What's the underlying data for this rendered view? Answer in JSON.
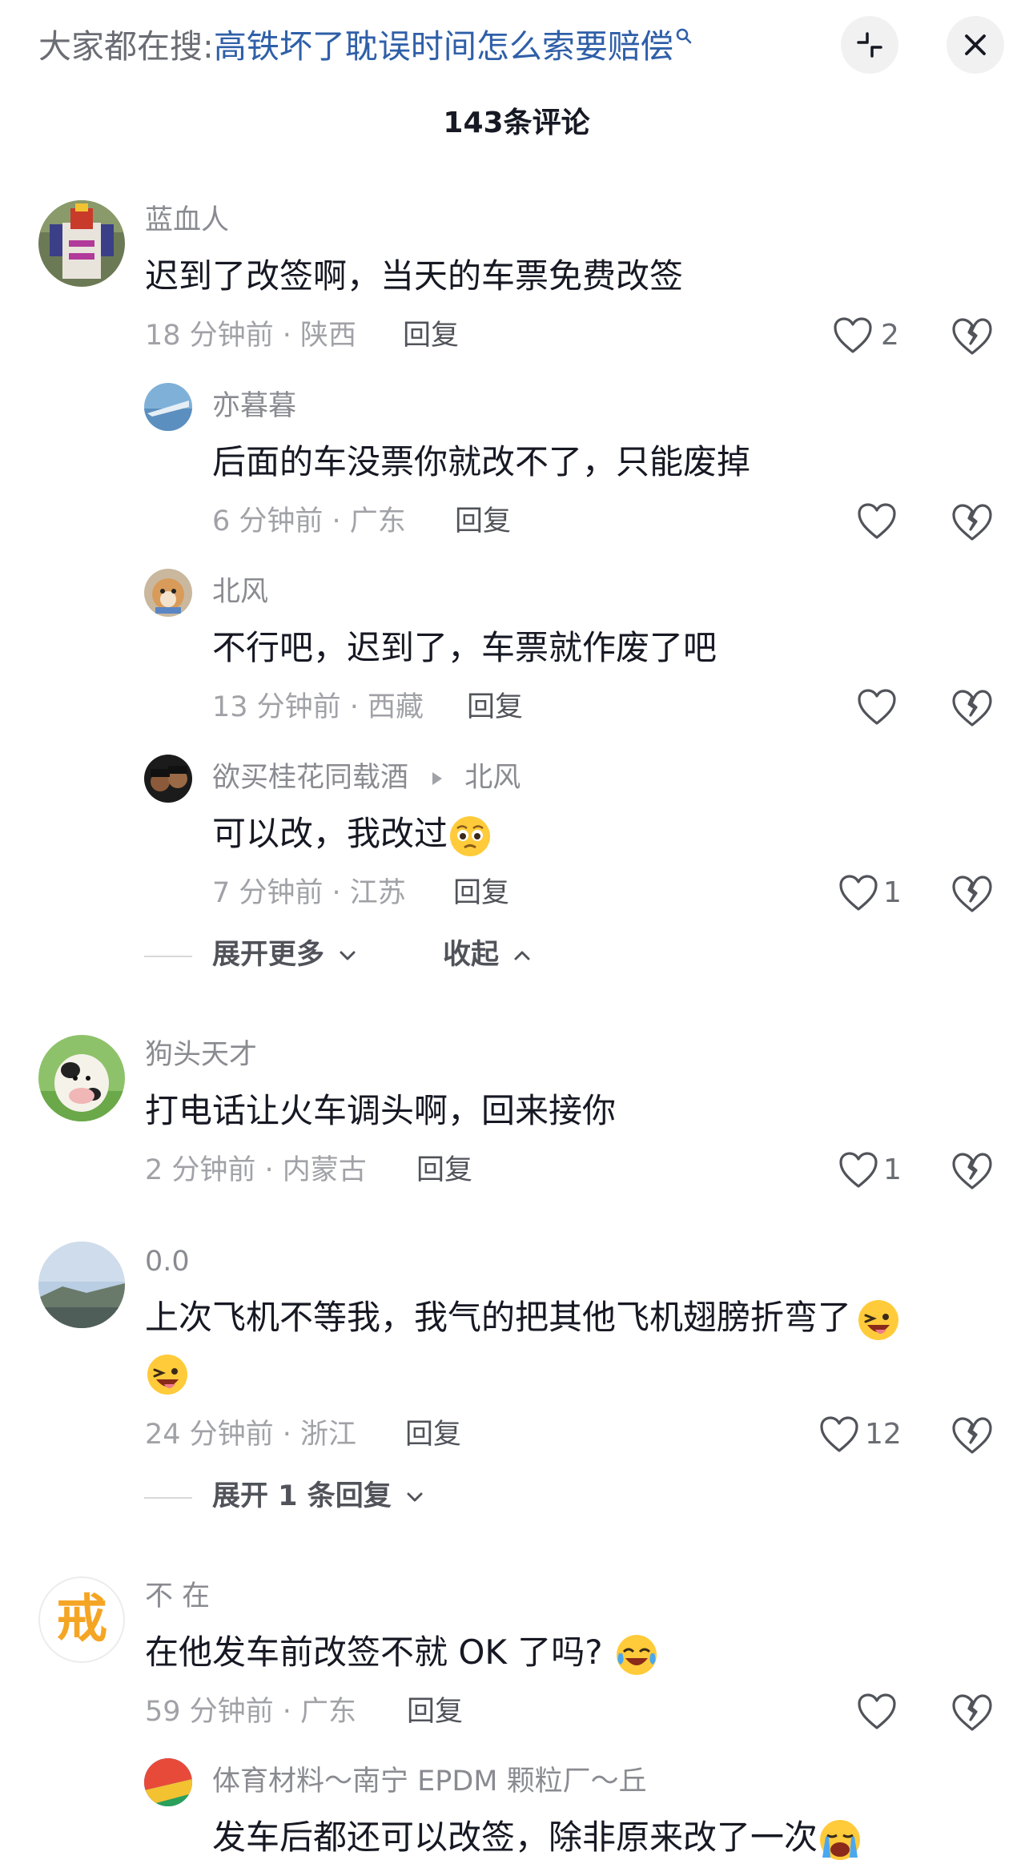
{
  "header": {
    "search_prefix": "大家都在搜:",
    "search_query": "高铁坏了耽误时间怎么索要赔偿",
    "search_icon": "search-icon",
    "minimize_icon": "minimize-icon",
    "close_icon": "close-icon"
  },
  "comments_header": {
    "count_label": "143条评论"
  },
  "comments": [
    {
      "username": "蓝血人",
      "text": "迟到了改签啊，当天的车票免费改签",
      "meta": "18 分钟前 · 陕西",
      "reply_label": "回复",
      "likes": "2",
      "replies": [
        {
          "username": "亦暮暮",
          "text": "后面的车没票你就改不了，只能废掉",
          "meta": "6 分钟前 · 广东",
          "reply_label": "回复",
          "likes": ""
        },
        {
          "username": "北风",
          "text": "不行吧，迟到了，车票就作废了吧",
          "meta": "13 分钟前 · 西藏",
          "reply_label": "回复",
          "likes": ""
        },
        {
          "username": "欲买桂花同载酒",
          "reply_to": "北风",
          "text": "可以改，我改过",
          "meta": "7 分钟前 · 江苏",
          "reply_label": "回复",
          "likes": "1"
        }
      ],
      "expand_more_label": "展开更多",
      "collapse_label": "收起"
    },
    {
      "username": "狗头天才",
      "text": "打电话让火车调头啊，回来接你",
      "meta": "2 分钟前 · 内蒙古",
      "reply_label": "回复",
      "likes": "1"
    },
    {
      "username": "0.0",
      "text": "上次飞机不等我，我气的把其他飞机翅膀折弯了",
      "meta": "24 分钟前 · 浙江",
      "reply_label": "回复",
      "likes": "12",
      "expand_label": "展开 1 条回复"
    },
    {
      "username": "不 在",
      "avatar_text": "戒",
      "text": "在他发车前改签不就 OK 了吗?",
      "meta": "59 分钟前 · 广东",
      "reply_label": "回复",
      "likes": "",
      "replies": [
        {
          "username": "体育材料～南宁 EPDM 颗粒厂～丘",
          "text": "发车后都还可以改签，除非原来改了一次"
        }
      ]
    }
  ],
  "colors": {
    "link_blue": "#2f5fa8",
    "text_primary": "#161823",
    "text_secondary": "#8a8b91",
    "avatar_text_orange": "#f5a524"
  }
}
